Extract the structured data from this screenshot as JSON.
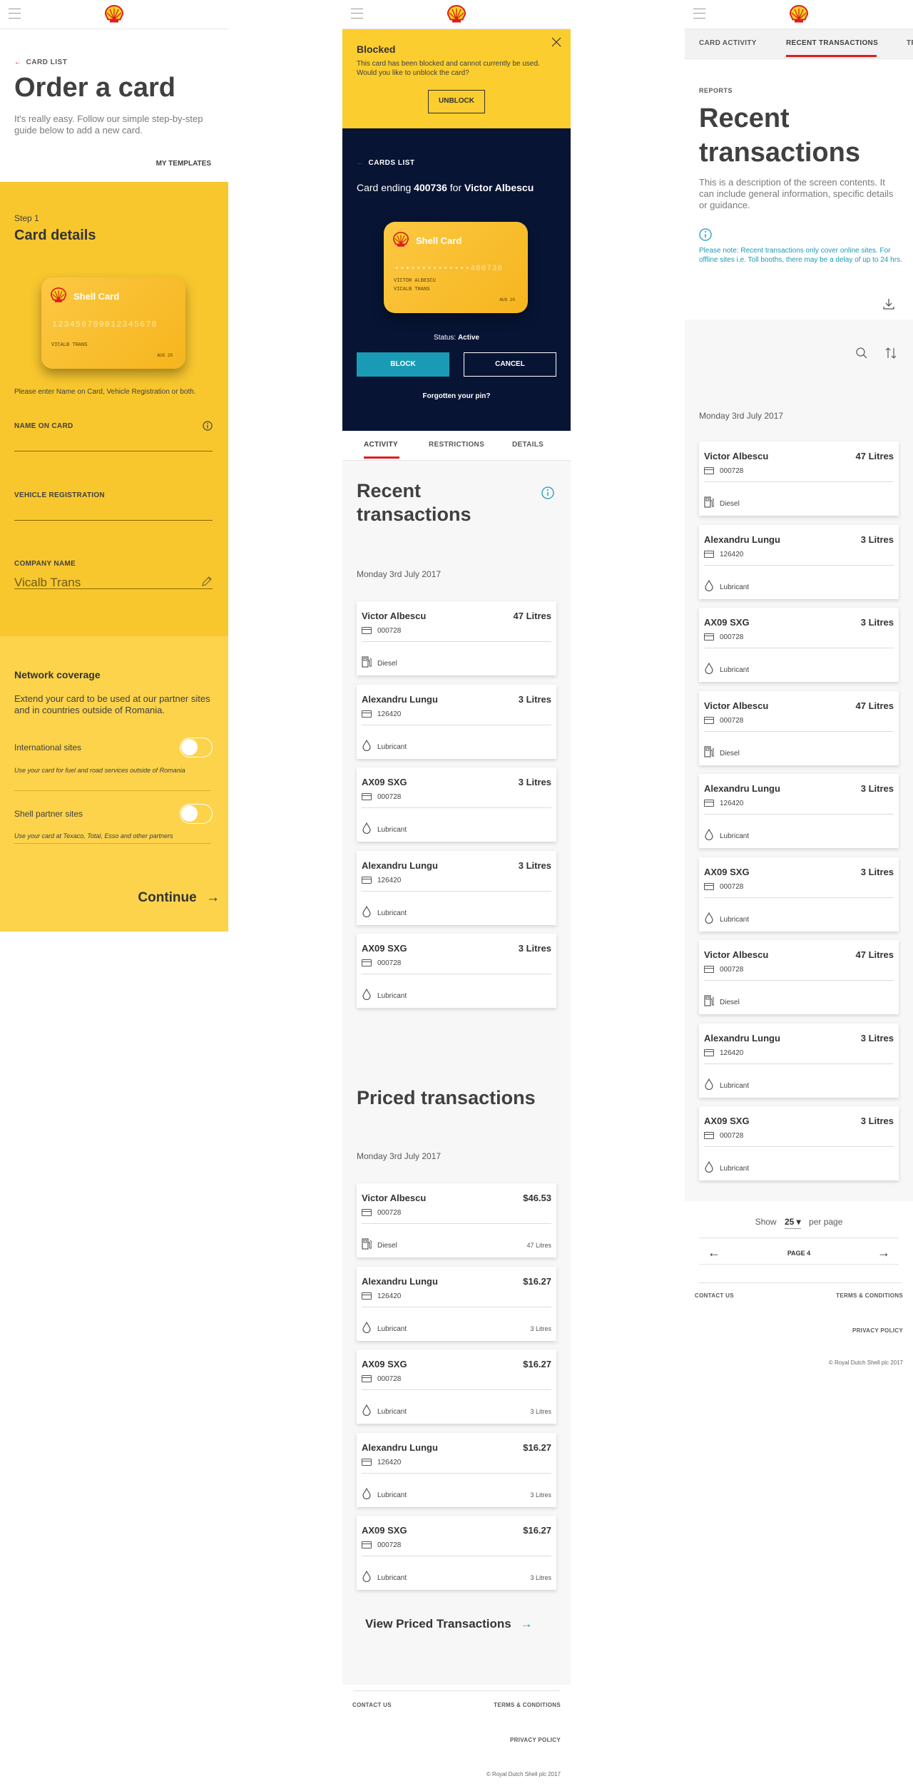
{
  "brand": {
    "accent": "#dd1d21",
    "yellow": "#f8c72e",
    "navy": "#081434",
    "teal": "#1a9bb5"
  },
  "screen1": {
    "back": "CARD LIST",
    "title": "Order a card",
    "intro": "It's really easy. Follow our simple step-by-step guide below to add a new card.",
    "my_templates": "MY TEMPLATES",
    "step": "Step 1",
    "step_title": "Card details",
    "card": {
      "title": "Shell Card",
      "number": "123456789012345678",
      "holder": "VICALB TRANS",
      "expiry": "AUG 20"
    },
    "hint": "Please enter Name on Card, Vehicle Registration or both.",
    "name_label": "NAME ON CARD",
    "vehicle_label": "VEHICLE REGISTRATION",
    "company_label": "COMPANY NAME",
    "company_value": "Vicalb Trans",
    "network_title": "Network coverage",
    "network_desc": "Extend your card to be used at our partner sites and in countries outside of Romania.",
    "intl_label": "International sites",
    "intl_desc": "Use your card for fuel and road services outside of Romania",
    "partner_label": "Shell partner sites",
    "partner_desc": "Use your card at Texaco, Total, Esso and other partners",
    "continue": "Continue"
  },
  "screen2": {
    "blocked_title": "Blocked",
    "blocked_msg": "This card has been blocked and cannot currently be used. Would you like to unblock the card?",
    "unblock": "UNBLOCK",
    "back": "CARDS LIST",
    "card_prefix": "Card ending",
    "card_number": "400736",
    "card_for": "for",
    "card_owner": "Victor Albescu",
    "card": {
      "title": "Shell Card",
      "number": "••••••••••••••400736",
      "holder": "VICTOR ALBESCU",
      "company": "VICALB TRANS",
      "expiry": "AUG 20"
    },
    "status_label": "Status:",
    "status_value": "Active",
    "block": "BLOCK",
    "cancel": "CANCEL",
    "forgot": "Forgotten your pin?",
    "tabs": [
      "ACTIVITY",
      "RESTRICTIONS",
      "DETAILS"
    ],
    "recent_title": "Recent transactions",
    "date": "Monday 3rd July 2017",
    "recent": [
      {
        "name": "Victor Albescu",
        "amount": "47 Litres",
        "card": "000728",
        "product": "Diesel",
        "icon": "fuel-pump-icon"
      },
      {
        "name": "Alexandru Lungu",
        "amount": "3 Litres",
        "card": "126420",
        "product": "Lubricant",
        "icon": "drop-icon"
      },
      {
        "name": "AX09 SXG",
        "amount": "3 Litres",
        "card": "000728",
        "product": "Lubricant",
        "icon": "drop-icon"
      },
      {
        "name": "Alexandru Lungu",
        "amount": "3 Litres",
        "card": "126420",
        "product": "Lubricant",
        "icon": "drop-icon"
      },
      {
        "name": "AX09 SXG",
        "amount": "3 Litres",
        "card": "000728",
        "product": "Lubricant",
        "icon": "drop-icon"
      }
    ],
    "priced_title": "Priced transactions",
    "priced_date": "Monday 3rd July 2017",
    "priced": [
      {
        "name": "Victor Albescu",
        "amount": "$46.53",
        "card": "000728",
        "product": "Diesel",
        "qty": "47 Litres",
        "icon": "fuel-pump-icon"
      },
      {
        "name": "Alexandru Lungu",
        "amount": "$16.27",
        "card": "126420",
        "product": "Lubricant",
        "qty": "3 Litres",
        "icon": "drop-icon"
      },
      {
        "name": "AX09 SXG",
        "amount": "$16.27",
        "card": "000728",
        "product": "Lubricant",
        "qty": "3 Litres",
        "icon": "drop-icon"
      },
      {
        "name": "Alexandru Lungu",
        "amount": "$16.27",
        "card": "126420",
        "product": "Lubricant",
        "qty": "3 Litres",
        "icon": "drop-icon"
      },
      {
        "name": "AX09 SXG",
        "amount": "$16.27",
        "card": "000728",
        "product": "Lubricant",
        "qty": "3 Litres",
        "icon": "drop-icon"
      }
    ],
    "view_priced": "View Priced Transactions",
    "footer": {
      "contact": "CONTACT US",
      "terms": "TERMS & CONDITIONS",
      "privacy": "PRIVACY POLICY",
      "copyright": "© Royal Dutch Shell plc 2017"
    }
  },
  "screen3": {
    "tabs": [
      "CARD ACTIVITY",
      "RECENT TRANSACTIONS",
      "TR"
    ],
    "eyebrow": "REPORTS",
    "title": "Recent transactions",
    "desc": "This is a description of the screen contents. It can include general information, specific details or guidance.",
    "note": "Please note: Recent transactions only cover online sites. For offline sites i.e. Toll booths, there may be a delay of up to 24 hrs.",
    "date": "Monday 3rd July 2017",
    "transactions": [
      {
        "name": "Victor Albescu",
        "amount": "47 Litres",
        "card": "000728",
        "product": "Diesel",
        "icon": "fuel-pump-icon"
      },
      {
        "name": "Alexandru Lungu",
        "amount": "3 Litres",
        "card": "126420",
        "product": "Lubricant",
        "icon": "drop-icon"
      },
      {
        "name": "AX09 SXG",
        "amount": "3 Litres",
        "card": "000728",
        "product": "Lubricant",
        "icon": "drop-icon"
      },
      {
        "name": "Victor Albescu",
        "amount": "47 Litres",
        "card": "000728",
        "product": "Diesel",
        "icon": "fuel-pump-icon"
      },
      {
        "name": "Alexandru Lungu",
        "amount": "3 Litres",
        "card": "126420",
        "product": "Lubricant",
        "icon": "drop-icon"
      },
      {
        "name": "AX09 SXG",
        "amount": "3 Litres",
        "card": "000728",
        "product": "Lubricant",
        "icon": "drop-icon"
      },
      {
        "name": "Victor Albescu",
        "amount": "47 Litres",
        "card": "000728",
        "product": "Diesel",
        "icon": "fuel-pump-icon"
      },
      {
        "name": "Alexandru Lungu",
        "amount": "3 Litres",
        "card": "126420",
        "product": "Lubricant",
        "icon": "drop-icon"
      },
      {
        "name": "AX09 SXG",
        "amount": "3 Litres",
        "card": "000728",
        "product": "Lubricant",
        "icon": "drop-icon"
      }
    ],
    "show": "Show",
    "per_page_value": "25",
    "per_page": "per page",
    "page": "PAGE 4",
    "footer": {
      "contact": "CONTACT US",
      "terms": "TERMS & CONDITIONS",
      "privacy": "PRIVACY POLICY",
      "copyright": "© Royal Dutch Shell plc 2017"
    }
  }
}
